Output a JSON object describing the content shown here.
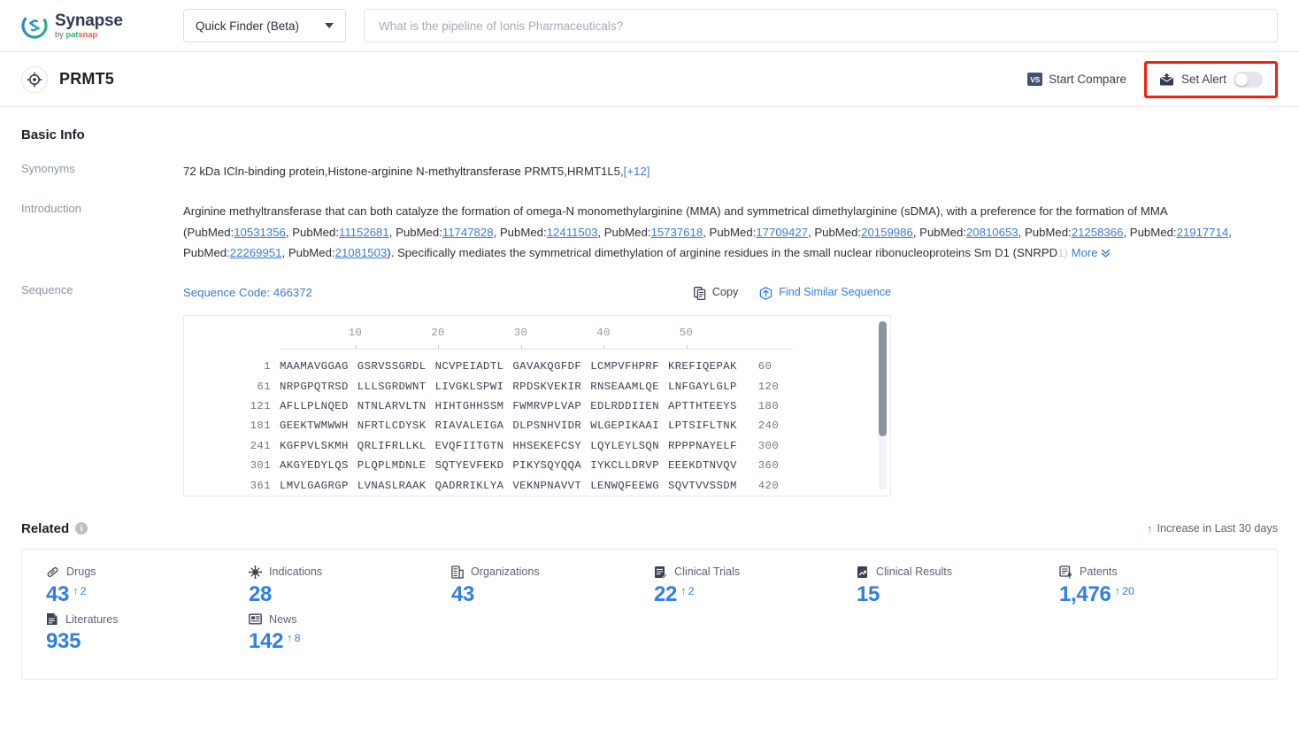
{
  "header": {
    "logo": {
      "title": "Synapse",
      "by": "by ",
      "pat": "pat",
      "snap": "snap"
    },
    "finder": {
      "label": "Quick Finder (Beta)",
      "icon": "chevron-down-icon"
    },
    "search": {
      "value": "",
      "placeholder": "What is the pipeline of Ionis Pharmaceuticals?"
    }
  },
  "subheader": {
    "icon": "target-icon",
    "title": "PRMT5",
    "compare": {
      "badge": "VS",
      "label": "Start Compare"
    },
    "alert": {
      "label": "Set Alert",
      "icon": "alert-mail-icon",
      "toggle_on": false,
      "highlight_color": "#f91d0d"
    }
  },
  "basic_info": {
    "title": "Basic Info",
    "synonyms": {
      "label": "Synonyms",
      "value": "72 kDa ICln-binding protein,Histone-arginine N-methyltransferase PRMT5,HRMT1L5,",
      "more_count": "[+12]"
    },
    "introduction": {
      "label": "Introduction",
      "text_1": "Arginine methyltransferase that can both catalyze the formation of omega-N monomethylarginine (MMA) and symmetrical dimethylarginine (sDMA), with a preference for the formation of MMA",
      "open_paren": "(",
      "pubmed_prefix": "PubMed:",
      "pubmed_ids": [
        "10531356",
        "11152681",
        "11747828",
        "12411503",
        "15737618",
        "17709427",
        "20159986",
        "20810653",
        "21258366",
        "21917714",
        "22269951",
        "21081503"
      ],
      "text_2": "). Specifically mediates the symmetrical dimethylation of arginine residues in the small nuclear ribonucleoproteins Sm D1 (SNRPD",
      "faded_tail": "1)",
      "more_label": "More",
      "more_icon": "chevron-double-down-icon"
    },
    "sequence": {
      "label": "Sequence",
      "code_label": "Sequence Code: 466372",
      "copy_label": "Copy",
      "copy_icon": "copy-icon",
      "find_label": "Find Similar Sequence",
      "find_icon": "find-similar-icon",
      "ruler_ticks": [
        "10",
        "20",
        "30",
        "40",
        "50"
      ],
      "rows": [
        {
          "start": "1",
          "chunks": [
            "MAAMAVGGAG",
            "GSRVSSGRDL",
            "NCVPEIADTL",
            "GAVAKQGFDF",
            "LCMPVFHPRF",
            "KREFIQEPAK"
          ],
          "end": "60"
        },
        {
          "start": "61",
          "chunks": [
            "NRPGPQTRSD",
            "LLLSGRDWNT",
            "LIVGKLSPWI",
            "RPDSKVEKIR",
            "RNSEAAMLQE",
            "LNFGAYLGLP"
          ],
          "end": "120"
        },
        {
          "start": "121",
          "chunks": [
            "AFLLPLNQED",
            "NTNLARVLTN",
            "HIHTGHHSSM",
            "FWMRVPLVAP",
            "EDLRDDIIEN",
            "APTTHTEEYS"
          ],
          "end": "180"
        },
        {
          "start": "181",
          "chunks": [
            "GEEKTWMWWH",
            "NFRTLCDYSK",
            "RIAVALEIGA",
            "DLPSNHVIDR",
            "WLGEPIKAAI",
            "LPTSIFLTNK"
          ],
          "end": "240"
        },
        {
          "start": "241",
          "chunks": [
            "KGFPVLSKMH",
            "QRLIFRLLKL",
            "EVQFIITGTN",
            "HHSEKEFCSY",
            "LQYLEYLSQN",
            "RPPPNAYELF"
          ],
          "end": "300"
        },
        {
          "start": "301",
          "chunks": [
            "AKGYEDYLQS",
            "PLQPLMDNLE",
            "SQTYEVFEKD",
            "PIKYSQYQQA",
            "IYKCLLDRVP",
            "EEEKDTNVQV"
          ],
          "end": "360"
        },
        {
          "start": "361",
          "chunks": [
            "LMVLGAGRGP",
            "LVNASLRAAK",
            "QADRRIKLYA",
            "VEKNPNAVVT",
            "LENWQFEEWG",
            "SQVTVVSSDM"
          ],
          "end": "420"
        }
      ]
    }
  },
  "related": {
    "title": "Related",
    "info_icon": "info-icon",
    "increase_note": "Increase in Last 30 days",
    "increase_icon": "arrow-up-icon",
    "stats": [
      {
        "icon": "capsule-icon",
        "label": "Drugs",
        "value": "43",
        "delta": "2"
      },
      {
        "icon": "virus-icon",
        "label": "Indications",
        "value": "28",
        "delta": ""
      },
      {
        "icon": "building-icon",
        "label": "Organizations",
        "value": "43",
        "delta": ""
      },
      {
        "icon": "clinical-trial-icon",
        "label": "Clinical Trials",
        "value": "22",
        "delta": "2"
      },
      {
        "icon": "clinical-result-icon",
        "label": "Clinical Results",
        "value": "15",
        "delta": ""
      },
      {
        "icon": "patent-icon",
        "label": "Patents",
        "value": "1,476",
        "delta": "20"
      },
      {
        "icon": "literature-icon",
        "label": "Literatures",
        "value": "935",
        "delta": ""
      },
      {
        "icon": "news-icon",
        "label": "News",
        "value": "142",
        "delta": "8"
      }
    ]
  },
  "colors": {
    "accent": "#2f7fe0",
    "link": "#3a7bd5",
    "green": "#2db84d",
    "alert_box": "#f91d0d"
  }
}
